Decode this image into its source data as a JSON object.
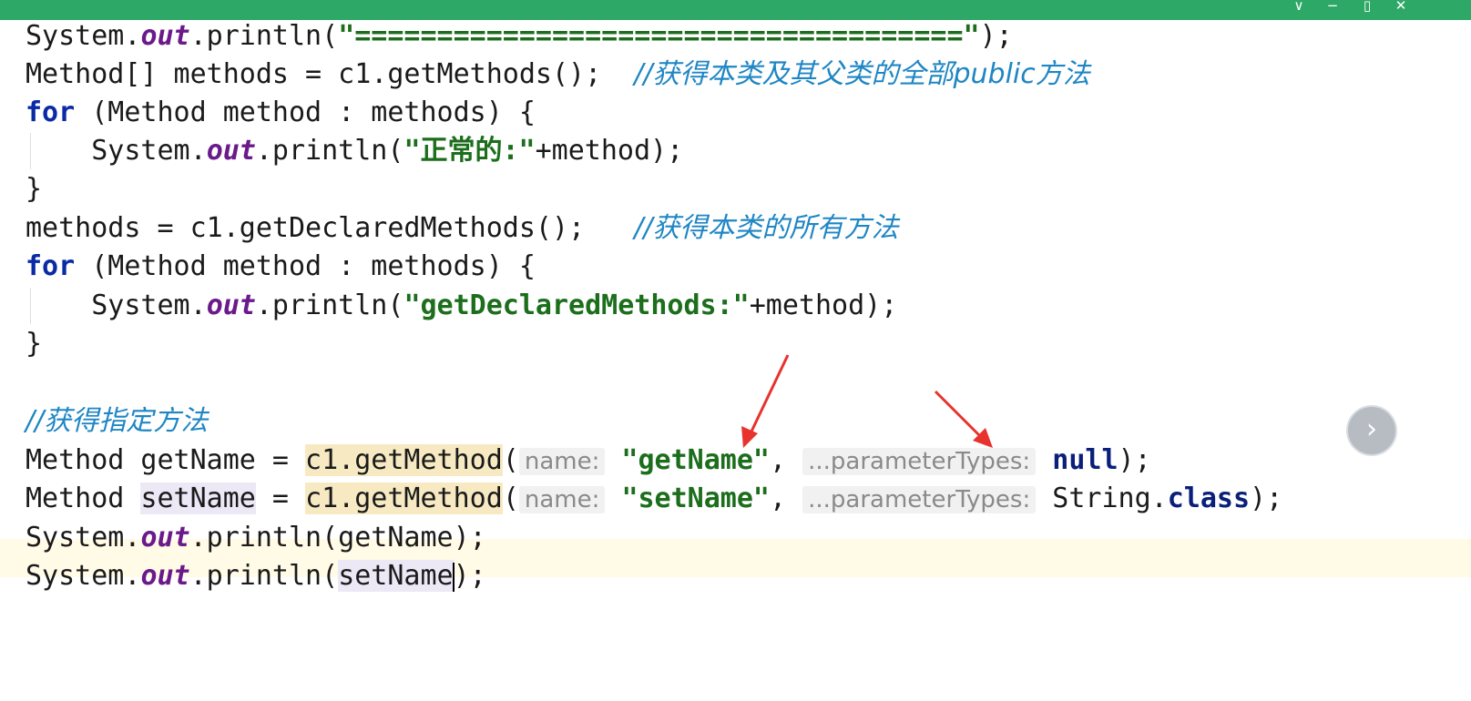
{
  "window": {
    "controls": {
      "dropdown_icon": "∨",
      "minimize_icon": "−",
      "maximize_icon": "▯",
      "close_icon": "✕"
    }
  },
  "code": {
    "l1": {
      "a": "System.",
      "b": "out",
      "c": ".println(",
      "d": "\"=====================================\"",
      "e": ");"
    },
    "l2": {
      "a": "Method[] methods = c1.getMethods();  ",
      "comment": "//获得本类及其父类的全部public方法"
    },
    "l3": {
      "kw": "for",
      "rest": " (Method method : methods) {"
    },
    "l4": {
      "a": "    System.",
      "b": "out",
      "c": ".println(",
      "d": "\"正常的:\"",
      "e": "+method);"
    },
    "l5": "}",
    "l6": {
      "a": "methods = c1.getDeclaredMethods();   ",
      "comment": "//获得本类的所有方法"
    },
    "l7": {
      "kw": "for",
      "rest": " (Method method : methods) {"
    },
    "l8": {
      "a": "    System.",
      "b": "out",
      "c": ".println(",
      "d": "\"getDeclaredMethods:\"",
      "e": "+method);"
    },
    "l9": "}",
    "l10": {
      "comment": "//获得指定方法"
    },
    "l11": {
      "a": "Method getName = ",
      "b": "c1.getMethod",
      "c": "(",
      "hint1": "name:",
      "d": "\"getName\"",
      "e": ", ",
      "hint2": "...parameterTypes:",
      "f": "null",
      "g": ");"
    },
    "l12": {
      "a": "Method ",
      "a2": "setName",
      "a3": " = ",
      "b": "c1.getMethod",
      "c": "(",
      "hint1": "name:",
      "d": "\"setName\"",
      "e": ", ",
      "hint2": "...parameterTypes:",
      "f": "String.",
      "g": "class",
      "h": ");"
    },
    "l13": {
      "a": "System.",
      "b": "out",
      "c": ".println(getName);"
    },
    "l14": {
      "a": "System.",
      "b": "out",
      "c": ".println(",
      "d": "setName",
      "e": ");"
    }
  },
  "overlay": {
    "nav_icon": "›",
    "annotation_color": "#e8322d"
  },
  "colors": {
    "titlebar": "#2ea866",
    "keyword": "#0a2aa6",
    "static_field": "#6a1a8a",
    "string": "#1c6e1c",
    "comment": "#1f86c4",
    "param_hint": "#8a8a8a"
  }
}
